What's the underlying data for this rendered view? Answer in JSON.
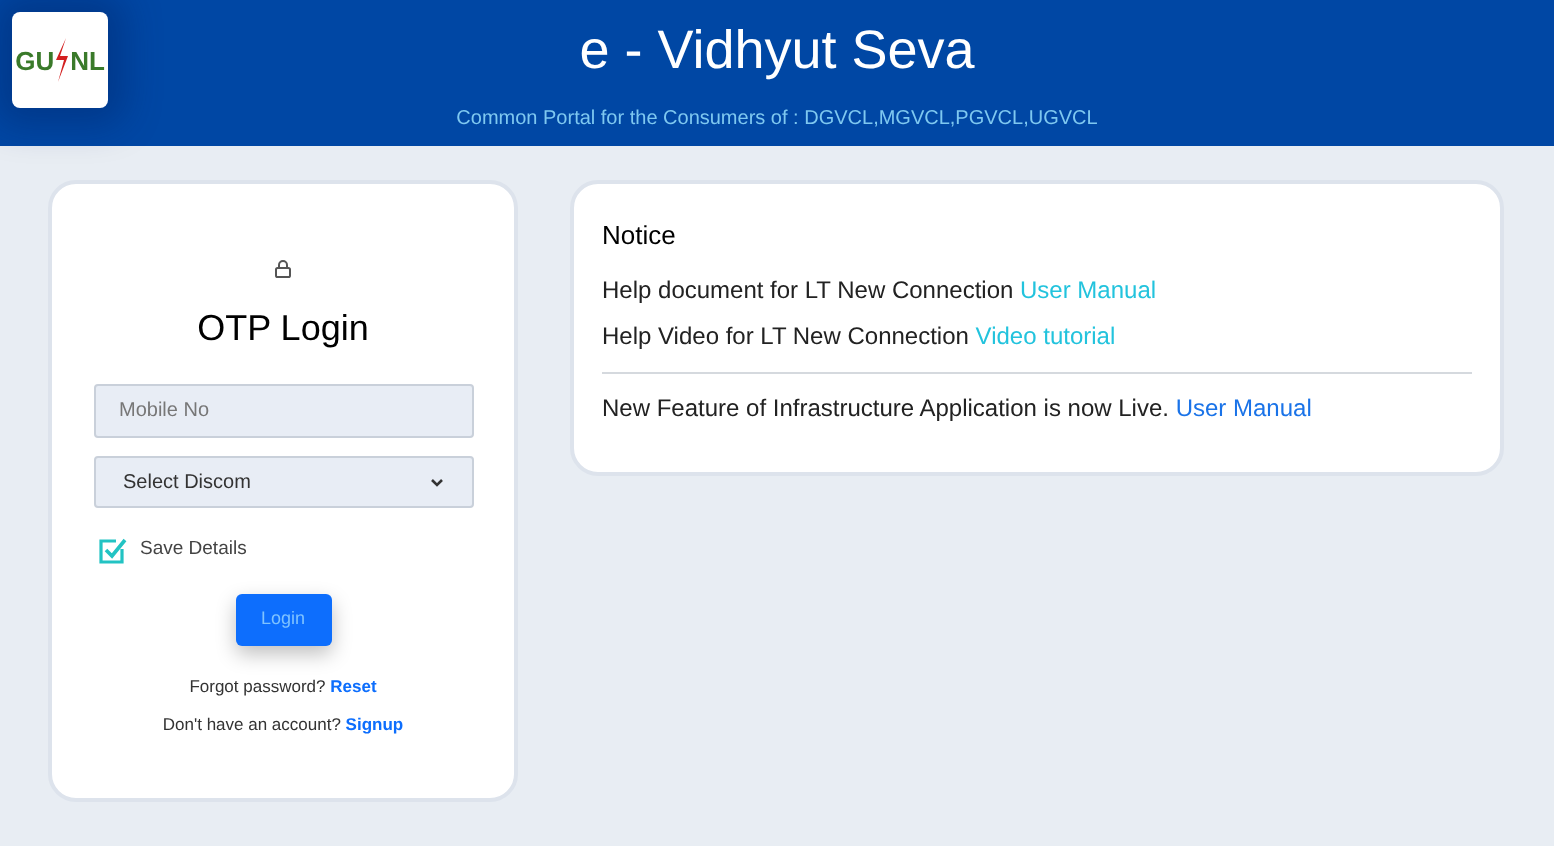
{
  "header": {
    "logo": {
      "left": "GU",
      "right": "NL"
    },
    "title": "e - Vidhyut Seva",
    "subtitle": "Common Portal for the Consumers of : DGVCL,MGVCL,PGVCL,UGVCL"
  },
  "login": {
    "title": "OTP Login",
    "mobile": {
      "placeholder": "Mobile No"
    },
    "discom": {
      "value": "Select Discom"
    },
    "save_details": {
      "label": "Save Details",
      "checked": true
    },
    "button": "Login",
    "forgot": {
      "text": "Forgot password?",
      "link": "Reset"
    },
    "signup": {
      "text": "Don't have an account?",
      "link": "Signup"
    }
  },
  "notice": {
    "title": "Notice",
    "items": [
      {
        "text": "Help document for LT New Connection",
        "link": "User Manual",
        "color": "#22c3dd",
        "divider_before": false
      },
      {
        "text": "Help Video for LT New Connection",
        "link": "Video tutorial",
        "color": "#22c3dd",
        "divider_before": false
      },
      {
        "text": "New Feature of Infrastructure Application is now Live.",
        "link": "User Manual",
        "color": "#1a73e8",
        "divider_before": true
      }
    ]
  }
}
